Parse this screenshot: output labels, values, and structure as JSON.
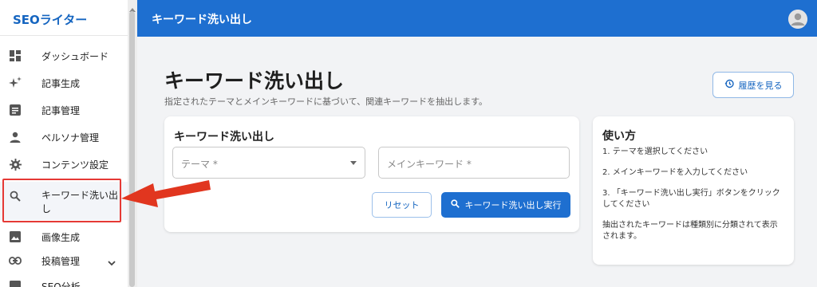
{
  "sidebar": {
    "brand": "SEOライター",
    "items": [
      {
        "label": "ダッシュボード",
        "icon": "dashboard-icon"
      },
      {
        "label": "記事生成",
        "icon": "sparkle-icon"
      },
      {
        "label": "記事管理",
        "icon": "article-icon"
      },
      {
        "label": "ペルソナ管理",
        "icon": "person-icon"
      },
      {
        "label": "コンテンツ設定",
        "icon": "gear-icon"
      },
      {
        "label": "キーワード洗い出し",
        "label_line1": "キーワード洗い出",
        "label_line2": "し",
        "icon": "search-icon",
        "active": true
      },
      {
        "label": "画像生成",
        "icon": "image-icon"
      },
      {
        "label": "投稿管理",
        "icon": "link-icon",
        "has_children": true
      },
      {
        "label": "SEO分析",
        "icon": "chart-icon"
      }
    ]
  },
  "header": {
    "title": "キーワード洗い出し",
    "avatar_icon": "account-circle-icon"
  },
  "main": {
    "title": "キーワード洗い出し",
    "description": "指定されたテーマとメインキーワードに基づいて、関連キーワードを抽出します。",
    "history_button": "履歴を見る",
    "form": {
      "title": "キーワード洗い出し",
      "theme_placeholder": "テーマ *",
      "keyword_placeholder": "メインキーワード *",
      "reset_label": "リセット",
      "execute_label": "キーワード洗い出し実行"
    },
    "help": {
      "title": "使い方",
      "steps": [
        "1. テーマを選択してください",
        "2. メインキーワードを入力してください",
        "3. 「キーワード洗い出し実行」ボタンをクリックしてください",
        "抽出されたキーワードは種類別に分類されて表示されます。"
      ]
    }
  },
  "colors": {
    "primary": "#1e6fd0",
    "annotation": "#e53935"
  }
}
